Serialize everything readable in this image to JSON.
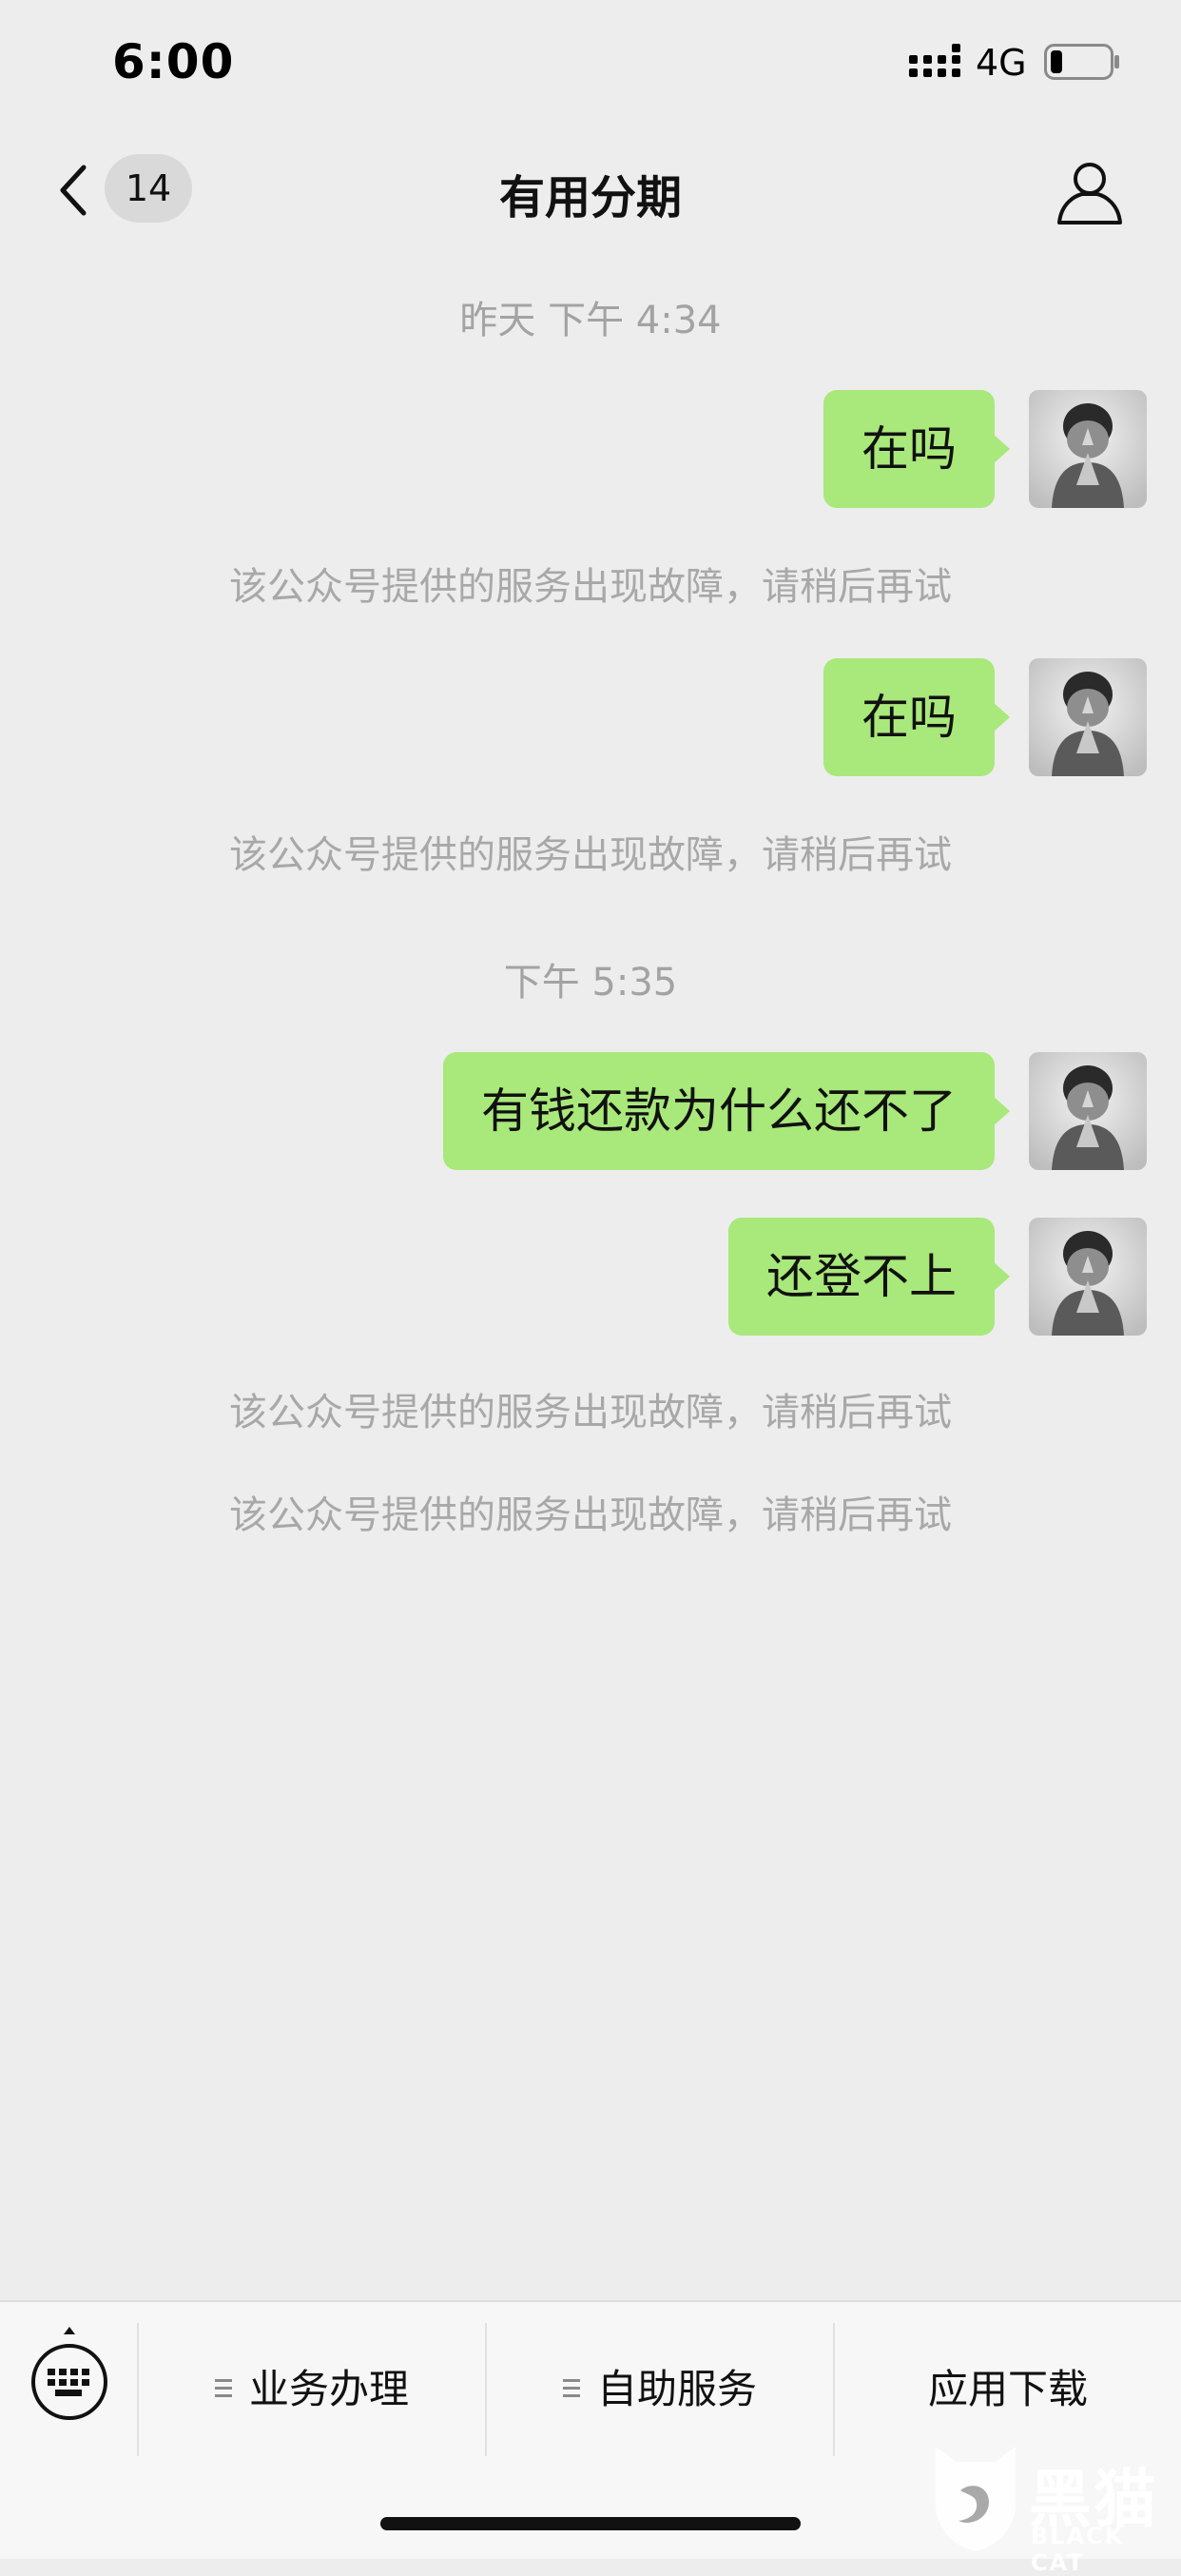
{
  "status_bar": {
    "time": "6:00",
    "network": "4G",
    "battery_level": 0.2
  },
  "nav": {
    "unread_count": "14",
    "title": "有用分期"
  },
  "messages": [
    {
      "type": "timestamp",
      "text": "昨天 下午 4:34"
    },
    {
      "type": "outgoing",
      "text": "在吗"
    },
    {
      "type": "system",
      "text": "该公众号提供的服务出现故障，请稍后再试"
    },
    {
      "type": "outgoing",
      "text": "在吗"
    },
    {
      "type": "system",
      "text": "该公众号提供的服务出现故障，请稍后再试"
    },
    {
      "type": "timestamp",
      "text": "下午 5:35"
    },
    {
      "type": "outgoing",
      "text": "有钱还款为什么还不了"
    },
    {
      "type": "outgoing",
      "text": "还登不上"
    },
    {
      "type": "system",
      "text": "该公众号提供的服务出现故障，请稍后再试"
    },
    {
      "type": "system",
      "text": "该公众号提供的服务出现故障，请稍后再试"
    }
  ],
  "bottom_menu": {
    "items": [
      {
        "label": "业务办理",
        "icon": "list-icon"
      },
      {
        "label": "自助服务",
        "icon": "list-icon"
      },
      {
        "label": "应用下载",
        "icon": ""
      }
    ]
  },
  "watermark": {
    "text": "黑猫",
    "sub": "BLACK CAT"
  },
  "colors": {
    "background": "#ededed",
    "bubble": "#a9e87a",
    "system_text": "#a8a8a8"
  }
}
